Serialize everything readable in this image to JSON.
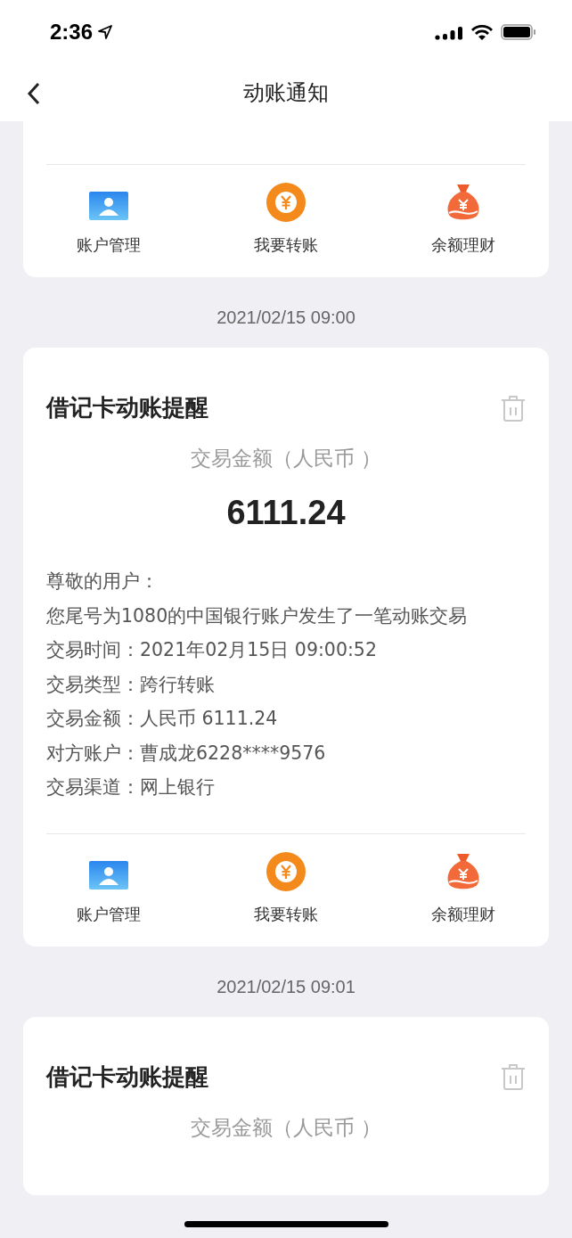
{
  "status_bar": {
    "time": "2:36"
  },
  "header": {
    "title": "动账通知"
  },
  "notices": [
    {
      "kind": "tail",
      "actions": [
        {
          "kind": "account",
          "label": "账户管理"
        },
        {
          "kind": "transfer",
          "label": "我要转账"
        },
        {
          "kind": "wealth",
          "label": "余额理财"
        }
      ]
    },
    {
      "kind": "full",
      "date": "2021/02/15 09:00",
      "title": "借记卡动账提醒",
      "amount_label": "交易金额（人民币 ）",
      "amount": "6111.24",
      "lines": [
        "尊敬的用户：",
        "您尾号为1080的中国银行账户发生了一笔动账交易",
        "交易时间：2021年02月15日 09:00:52",
        "交易类型：跨行转账",
        "交易金额：人民币 6111.24",
        "对方账户：曹成龙6228****9576",
        "交易渠道：网上银行"
      ],
      "actions": [
        {
          "kind": "account",
          "label": "账户管理"
        },
        {
          "kind": "transfer",
          "label": "我要转账"
        },
        {
          "kind": "wealth",
          "label": "余额理财"
        }
      ]
    },
    {
      "kind": "head",
      "date": "2021/02/15 09:01",
      "title": "借记卡动账提醒",
      "amount_label": "交易金额（人民币 ）"
    }
  ]
}
